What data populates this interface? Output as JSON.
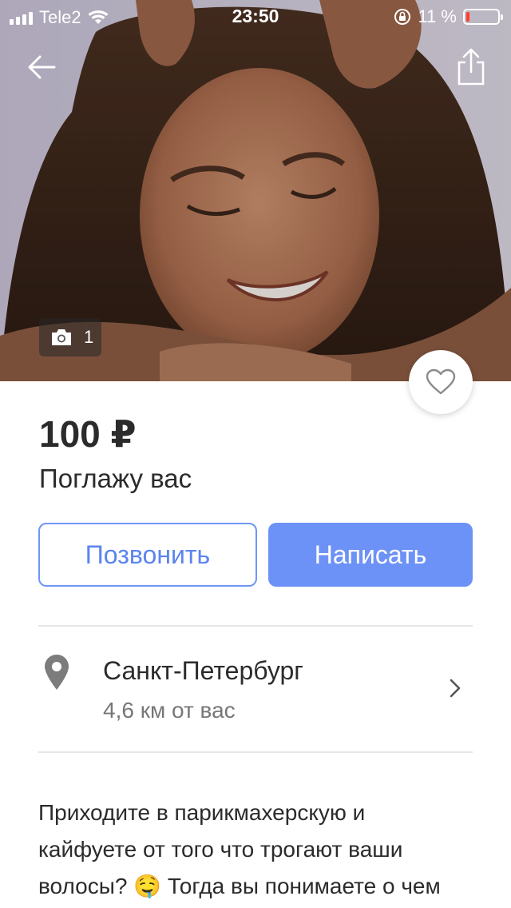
{
  "status_bar": {
    "carrier": "Tele2",
    "time": "23:50",
    "battery_text": "11 %",
    "battery_level": 0.11,
    "battery_color": "#ff3b30"
  },
  "hero": {
    "photo_count": "1",
    "icons": {
      "back": "arrow-left-icon",
      "share": "share-icon",
      "photo": "camera-icon",
      "favorite": "heart-icon"
    }
  },
  "listing": {
    "price": "100 ₽",
    "title": "Поглажу вас"
  },
  "actions": {
    "call_label": "Позвонить",
    "write_label": "Написать",
    "accent_color": "#6d92f7"
  },
  "location": {
    "city": "Санкт-Петербург",
    "distance": "4,6 км от вас",
    "icon": "map-pin-icon"
  },
  "description": {
    "line1": "Приходите в парикмахерскую и",
    "line2": "кайфуете от того что трогают ваши",
    "line3_before": "волосы?",
    "emoji": "🤤",
    "line3_after": "Тогда вы понимаете о чем"
  }
}
